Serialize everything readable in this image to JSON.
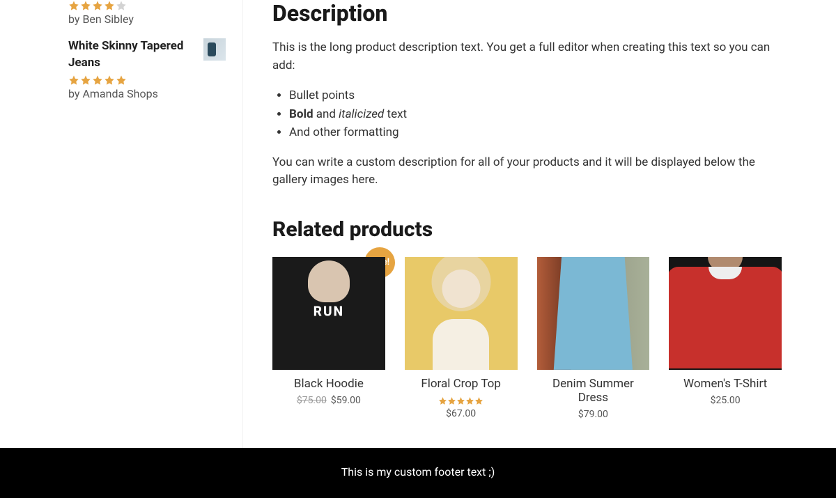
{
  "sidebar": {
    "reviews": [
      {
        "product": "",
        "stars": 4,
        "by": "by Ben Sibley"
      },
      {
        "product": "White Skinny Tapered Jeans",
        "stars": 5,
        "by": "by Amanda Shops"
      }
    ]
  },
  "description": {
    "heading": "Description",
    "intro": "This is the long product description text. You get a full editor when creating this text so you can add:",
    "bullets": {
      "b1": "Bullet points",
      "b2_bold": "Bold",
      "b2_and": " and ",
      "b2_italic": "italicized",
      "b2_tail": " text",
      "b3": "And other formatting"
    },
    "outro": "You can write a custom description for all of your products and it will be displayed below the gallery images here."
  },
  "related": {
    "heading": "Related products",
    "sale_label": "Sale!",
    "products": [
      {
        "name": "Black Hoodie",
        "old_price": "$75.00",
        "price": "$59.00",
        "sale": true
      },
      {
        "name": "Floral Crop Top",
        "stars": 5,
        "price": "$67.00"
      },
      {
        "name": "Denim Summer Dress",
        "price": "$79.00"
      },
      {
        "name": "Women's T-Shirt",
        "price": "$25.00"
      }
    ]
  },
  "footer": {
    "text": "This is my custom footer text ;)"
  }
}
